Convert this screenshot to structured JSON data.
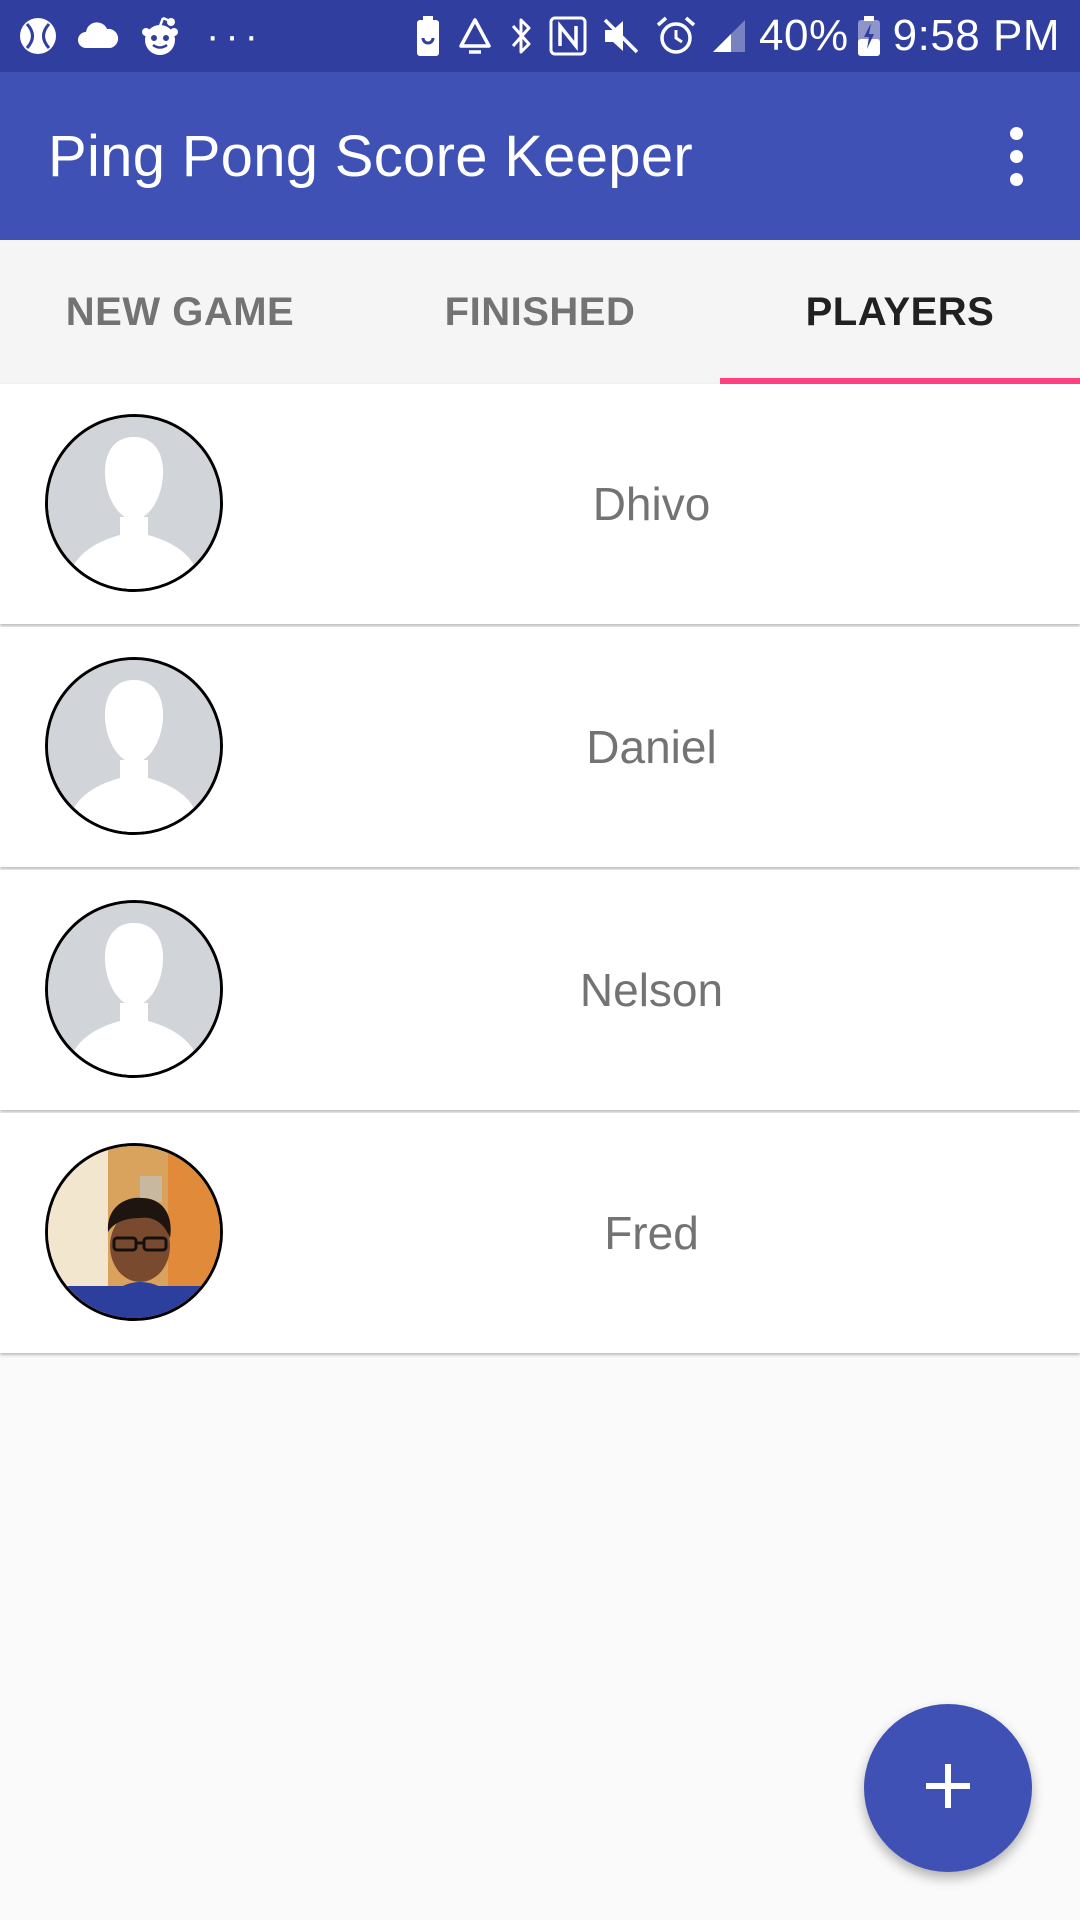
{
  "status_bar": {
    "left_icons": [
      "baseball-icon",
      "cloud-icon",
      "reddit-icon"
    ],
    "more_notifications": "···",
    "right_icons": [
      "battery-saver-icon",
      "recycle-icon",
      "bluetooth-icon",
      "nfc-icon",
      "mute-icon",
      "alarm-icon",
      "signal-icon"
    ],
    "battery_percent": "40%",
    "time": "9:58 PM"
  },
  "app_bar": {
    "title": "Ping Pong Score Keeper",
    "menu_icon": "more-vert-icon"
  },
  "tabs": [
    {
      "label": "NEW GAME",
      "active": false
    },
    {
      "label": "FINISHED",
      "active": false
    },
    {
      "label": "PLAYERS",
      "active": true
    }
  ],
  "players": [
    {
      "name": "Dhivo",
      "avatar": "default-avatar-icon"
    },
    {
      "name": "Daniel",
      "avatar": "default-avatar-icon"
    },
    {
      "name": "Nelson",
      "avatar": "default-avatar-icon"
    },
    {
      "name": "Fred",
      "avatar": "photo"
    }
  ],
  "fab": {
    "icon": "plus-icon"
  },
  "colors": {
    "status_bar": "#303f9f",
    "primary": "#3f51b5",
    "accent": "#ff4081",
    "background": "#fafafa",
    "avatar_placeholder": "#d1d4d9"
  }
}
